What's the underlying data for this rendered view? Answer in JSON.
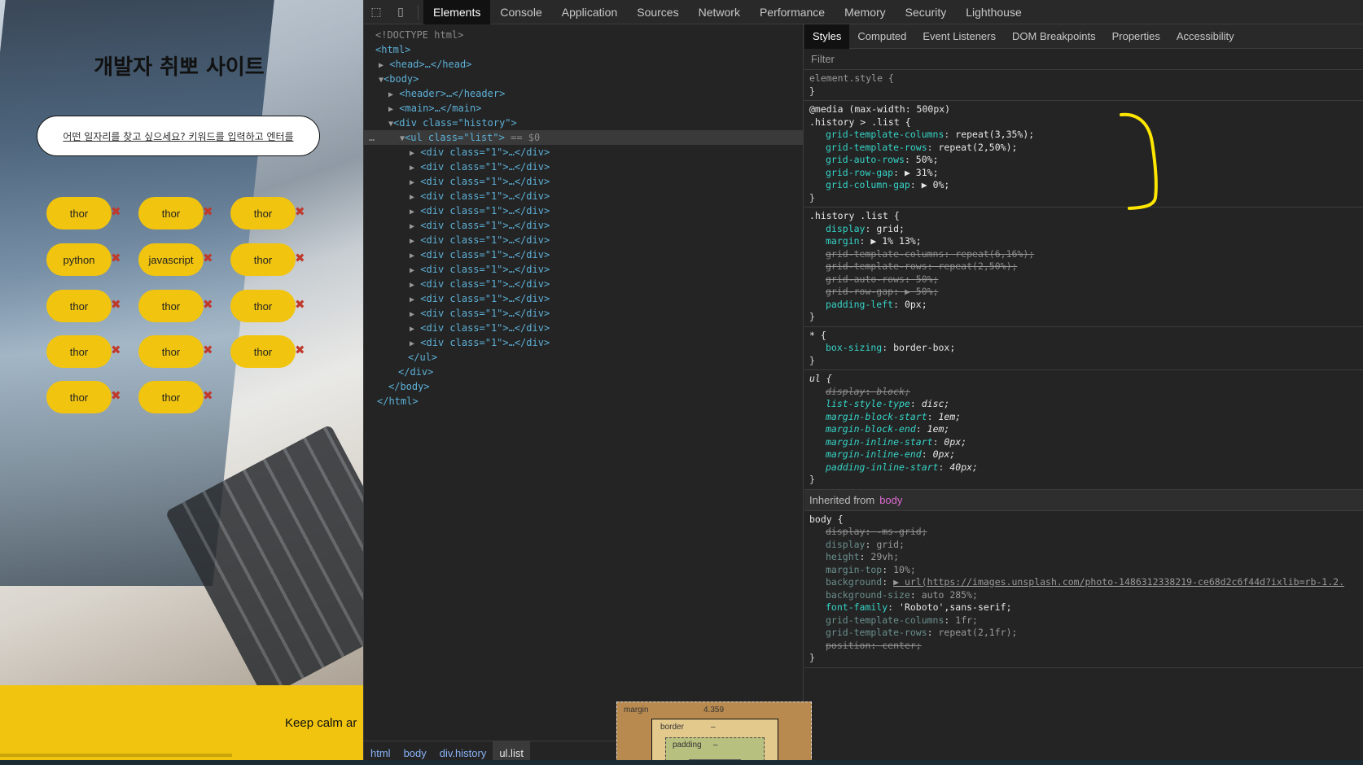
{
  "page_preview": {
    "site_title": "개발자 취뽀 사이트",
    "search_placeholder": "어떤 일자리를 찾고 싶으세요? 키워드를 입력하고 엔터를",
    "chips": [
      "thor",
      "thor",
      "thor",
      "python",
      "javascript",
      "thor",
      "thor",
      "thor",
      "thor",
      "thor",
      "thor",
      "thor",
      "thor",
      "thor"
    ],
    "remove_glyph": "✖",
    "footer_text": "Keep calm ar"
  },
  "devtools": {
    "main_tabs": [
      "Elements",
      "Console",
      "Application",
      "Sources",
      "Network",
      "Performance",
      "Memory",
      "Security",
      "Lighthouse"
    ],
    "active_main_tab": "Elements",
    "dom": {
      "doctype": "<!DOCTYPE html>",
      "html_open": "<html>",
      "head": "<head>…</head>",
      "body_open": "<body>",
      "header": "<header>…</header>",
      "main": "<main>…</main>",
      "div_history": "<div class=\"history\">",
      "ul_list": "<ul class=\"list\">",
      "ul_eq": "== $0",
      "div_item": "<div class=\"1\">…</div>",
      "ul_close": "</ul>",
      "div_close": "</div>",
      "body_close": "</body>",
      "html_close": "</html>",
      "ellipsis": "…"
    },
    "breadcrumbs": [
      "html",
      "body",
      "div.history",
      "ul.list"
    ],
    "style_tabs": [
      "Styles",
      "Computed",
      "Event Listeners",
      "DOM Breakpoints",
      "Properties",
      "Accessibility"
    ],
    "filter_placeholder": "Filter",
    "rules": {
      "element_style": "element.style {",
      "media_query": "@media (max-width: 500px)",
      "media_selector": ".history > .list {",
      "media_props": [
        {
          "name": "grid-template-columns",
          "value": "repeat(3,35%);"
        },
        {
          "name": "grid-template-rows",
          "value": "repeat(2,50%);"
        },
        {
          "name": "grid-auto-rows",
          "value": "50%;"
        },
        {
          "name": "grid-row-gap",
          "value": "▶ 31%;"
        },
        {
          "name": "grid-column-gap",
          "value": "▶ 0%;"
        }
      ],
      "history_selector": ".history .list {",
      "history_props": [
        {
          "name": "display",
          "value": "grid;",
          "struck": false
        },
        {
          "name": "margin",
          "value": "▶ 1% 13%;",
          "struck": false
        },
        {
          "name": "grid-template-columns",
          "value": "repeat(6,16%);",
          "struck": true
        },
        {
          "name": "grid-template-rows",
          "value": "repeat(2,50%);",
          "struck": true
        },
        {
          "name": "grid-auto-rows",
          "value": "50%;",
          "struck": true
        },
        {
          "name": "grid-row-gap",
          "value": "▶ 50%;",
          "struck": true
        },
        {
          "name": "padding-left",
          "value": "0px;",
          "struck": false
        }
      ],
      "star_selector": "* {",
      "star_props": [
        {
          "name": "box-sizing",
          "value": "border-box;"
        }
      ],
      "ul_selector": "ul {",
      "ul_props": [
        {
          "name": "display",
          "value": "block;",
          "struck": true
        },
        {
          "name": "list-style-type",
          "value": "disc;",
          "struck": false
        },
        {
          "name": "margin-block-start",
          "value": "1em;",
          "struck": false
        },
        {
          "name": "margin-block-end",
          "value": "1em;",
          "struck": false
        },
        {
          "name": "margin-inline-start",
          "value": "0px;",
          "struck": false
        },
        {
          "name": "margin-inline-end",
          "value": "0px;",
          "struck": false
        },
        {
          "name": "padding-inline-start",
          "value": "40px;",
          "struck": false
        }
      ],
      "inherited_label": "Inherited from",
      "inherited_from": "body",
      "body_selector": "body {",
      "body_props": [
        {
          "name": "display",
          "value": "-ms-grid;",
          "kind": "struck"
        },
        {
          "name": "display",
          "value": "grid;",
          "kind": "dim"
        },
        {
          "name": "height",
          "value": "29vh;",
          "kind": "dim"
        },
        {
          "name": "margin-top",
          "value": "10%;",
          "kind": "dim"
        },
        {
          "name": "background",
          "value": "▶ url(https://images.unsplash.com/photo-1486312338219-ce68d2c6f44d?ixlib=rb-1.2.",
          "kind": "dim"
        },
        {
          "name": "background-size",
          "value": "auto 285%;",
          "kind": "dim"
        },
        {
          "name": "font-family",
          "value": "'Roboto',sans-serif;",
          "kind": "normal"
        },
        {
          "name": "grid-template-columns",
          "value": "1fr;",
          "kind": "dim"
        },
        {
          "name": "grid-template-rows",
          "value": "repeat(2,1fr);",
          "kind": "dim"
        },
        {
          "name": "position",
          "value": "center;",
          "kind": "warn"
        }
      ],
      "close_brace": "}"
    },
    "box_model": {
      "margin_label": "margin",
      "margin_value": "4.359",
      "border_label": "border",
      "border_value": "–",
      "padding_label": "padding",
      "padding_value": "–"
    },
    "colors": {
      "accent_chip": "#f1c40f",
      "remove_x": "#c0392b",
      "annotation": "#ffe600"
    }
  }
}
